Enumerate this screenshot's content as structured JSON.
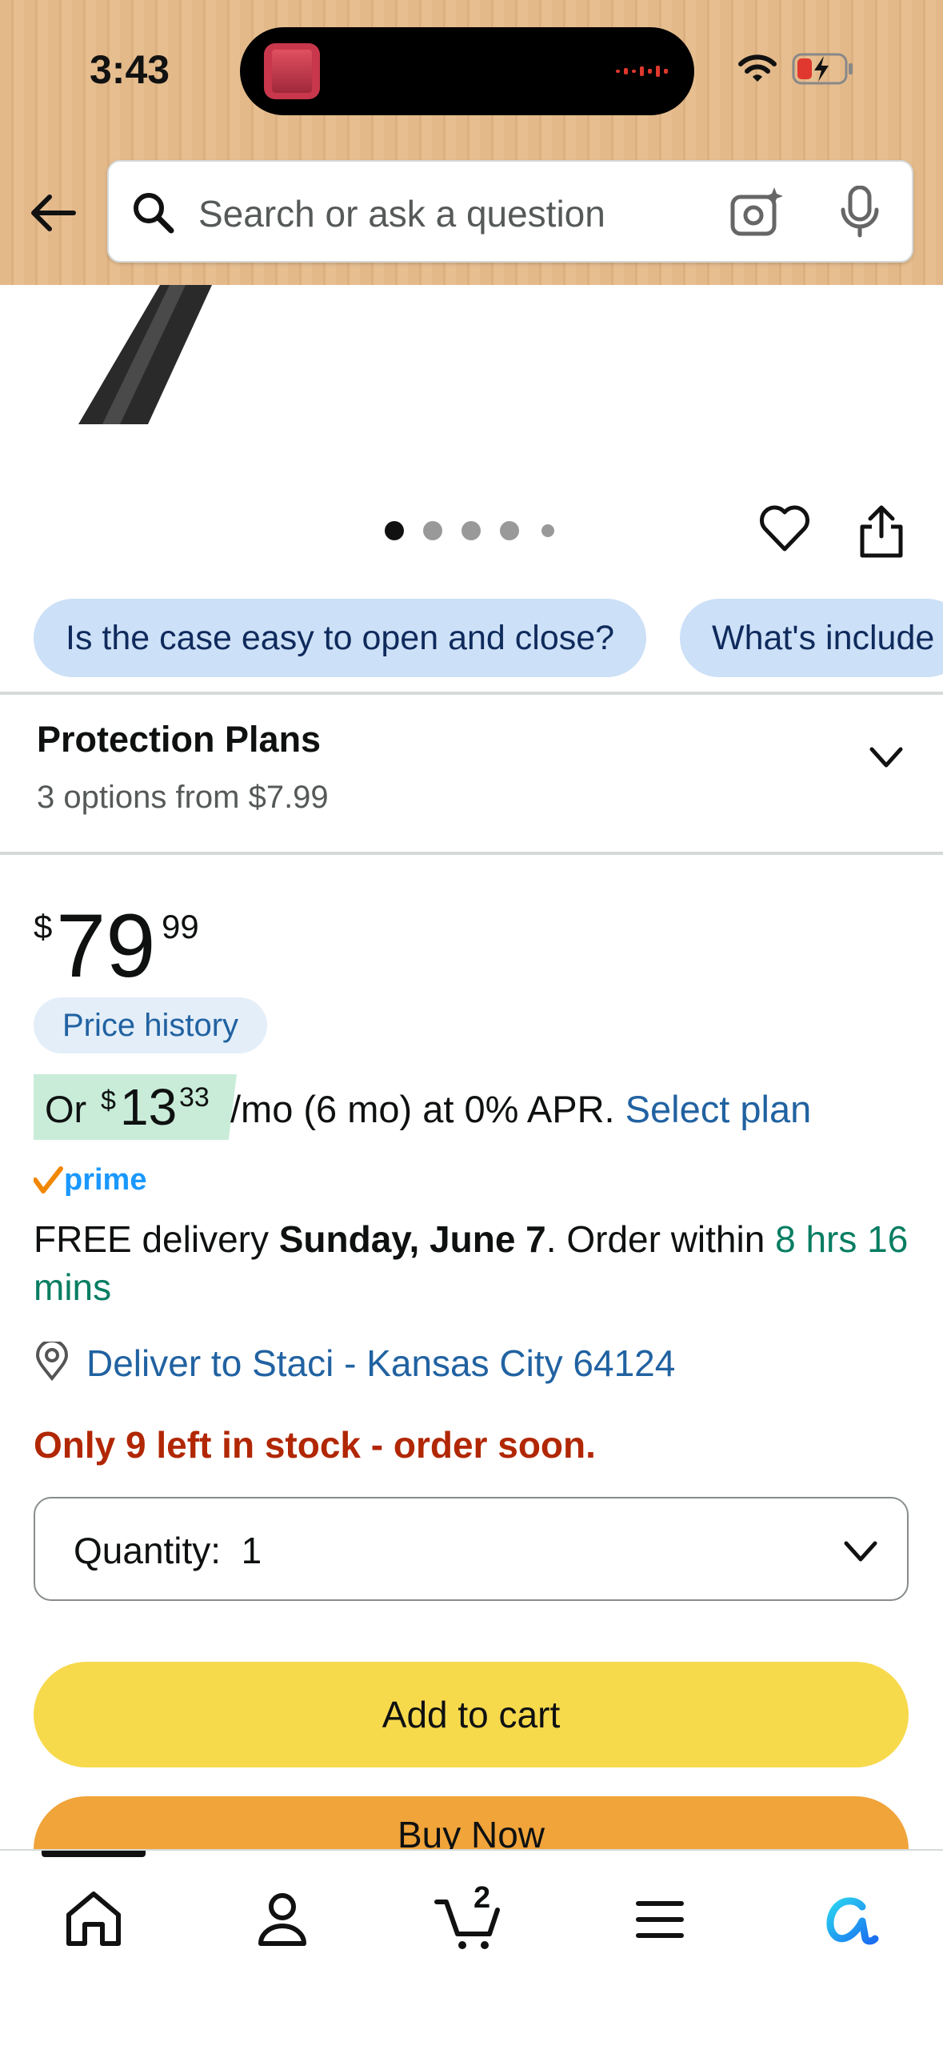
{
  "status_bar": {
    "time": "3:43"
  },
  "header": {
    "search_placeholder": "Search or ask a question"
  },
  "carousel": {
    "total_dots": 5,
    "active_index": 0
  },
  "question_chips": [
    {
      "label": "Is the case easy to open and close?"
    },
    {
      "label": "What's include"
    }
  ],
  "protection_plans": {
    "title": "Protection Plans",
    "subtitle": "3 options from $7.99"
  },
  "price": {
    "symbol": "$",
    "whole": "79",
    "fraction": "99"
  },
  "price_history_label": "Price history",
  "financing": {
    "prefix": "Or",
    "symbol": "$",
    "whole": "13",
    "fraction": "33",
    "terms": "/mo (6 mo) at 0% APR.",
    "link": "Select plan"
  },
  "prime_label": "prime",
  "delivery": {
    "prefix": "FREE delivery",
    "date": "Sunday, June 7",
    "middle": ". Order within",
    "countdown": "8 hrs 16 mins"
  },
  "deliver_to": "Deliver to Staci - Kansas City 64124",
  "stock_warning": "Only 9 left in stock - order soon.",
  "quantity": {
    "label": "Quantity:",
    "value": "1"
  },
  "buttons": {
    "add_to_cart": "Add to cart",
    "buy_now": "Buy Now"
  },
  "bottom_nav": {
    "cart_count": "2",
    "items": [
      {
        "icon": "home-icon"
      },
      {
        "icon": "profile-icon"
      },
      {
        "icon": "cart-icon"
      },
      {
        "icon": "menu-icon"
      },
      {
        "icon": "rufus-icon"
      }
    ]
  },
  "colors": {
    "header_bg": "#e3b98a",
    "chip_bg": "#cce0f7",
    "link": "#2162a1",
    "stock_red": "#b12704",
    "countdown_green": "#067d62",
    "add_to_cart": "#f7d94c",
    "buy_now": "#f0a43a"
  }
}
